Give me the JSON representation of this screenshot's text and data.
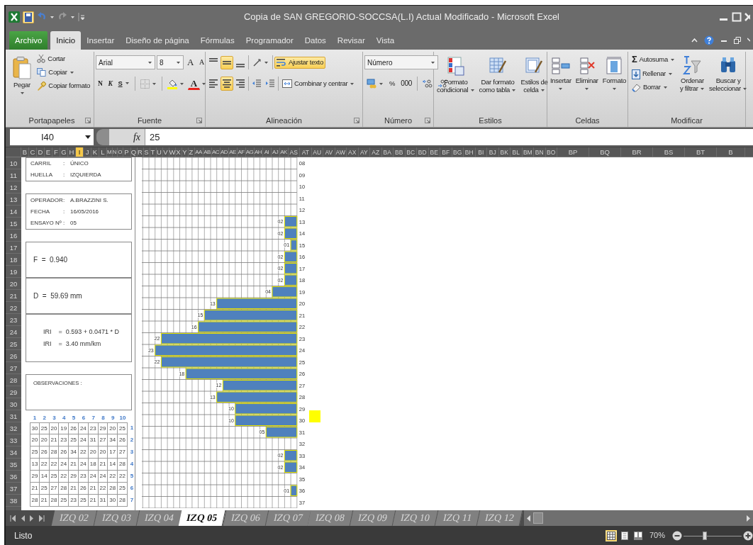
{
  "window": {
    "title": "Copia de SAN GREGORIO-SOCCSA(L.I) Actual Modificado  -  Microsoft Excel"
  },
  "ribbon_tabs": [
    {
      "label": "Archivo",
      "kind": "file",
      "selected": false
    },
    {
      "label": "Inicio",
      "kind": "tab",
      "selected": true
    },
    {
      "label": "Insertar",
      "kind": "tab",
      "selected": false
    },
    {
      "label": "Diseño de página",
      "kind": "tab",
      "selected": false
    },
    {
      "label": "Fórmulas",
      "kind": "tab",
      "selected": false
    },
    {
      "label": "Programador",
      "kind": "tab",
      "selected": false
    },
    {
      "label": "Datos",
      "kind": "tab",
      "selected": false
    },
    {
      "label": "Revisar",
      "kind": "tab",
      "selected": false
    },
    {
      "label": "Vista",
      "kind": "tab",
      "selected": false
    }
  ],
  "ribbon": {
    "clipboard": {
      "label": "Portapapeles",
      "paste": "Pegar",
      "cut": "Cortar",
      "copy": "Copiar",
      "format_painter": "Copiar formato"
    },
    "font": {
      "label": "Fuente",
      "font_name": "Arial",
      "font_size": "8",
      "grow": "A",
      "shrink": "A",
      "bold": "N",
      "italic": "K",
      "underline": "S",
      "font_color": "A"
    },
    "alignment": {
      "label": "Alineación",
      "align_buttons": [
        {
          "kind": "top",
          "selected": false
        },
        {
          "kind": "middle",
          "selected": true
        },
        {
          "kind": "bottom",
          "selected": false
        },
        {
          "kind": "left",
          "selected": false
        },
        {
          "kind": "center",
          "selected": true
        },
        {
          "kind": "right",
          "selected": false
        }
      ],
      "wrap_text": {
        "label": "Ajustar texto",
        "selected": true
      },
      "merge": "Combinar y centrar"
    },
    "number": {
      "label": "Número",
      "format": "Número",
      "percent": "%",
      "thousands": "000"
    },
    "styles": {
      "label": "Estilos",
      "buttons": [
        {
          "kind": "conditional",
          "lines": [
            "Formato",
            "condicional"
          ]
        },
        {
          "kind": "table",
          "lines": [
            "Dar formato",
            "como tabla"
          ]
        },
        {
          "kind": "cell",
          "lines": [
            "Estilos de",
            "celda"
          ]
        }
      ]
    },
    "cells": {
      "label": "Celdas",
      "buttons": [
        {
          "kind": "insert",
          "label": "Insertar"
        },
        {
          "kind": "delete",
          "label": "Eliminar"
        },
        {
          "kind": "format",
          "label": "Formato"
        }
      ]
    },
    "editing": {
      "label": "Modificar",
      "sigma": "Σ",
      "autosum": "Autosuma",
      "fill": "Rellenar",
      "clear": "Borrar",
      "sort": [
        "Ordenar",
        "y filtrar"
      ],
      "find": [
        "Buscar y",
        "seleccionar"
      ]
    }
  },
  "formula_bar": {
    "name_box": "I40",
    "fx": "fx",
    "value": "25"
  },
  "sheet": {
    "column_headers": [
      {
        "label": "B",
        "selected": false
      },
      {
        "label": "C",
        "selected": false
      },
      {
        "label": "D",
        "selected": false
      },
      {
        "label": "E",
        "selected": false
      },
      {
        "label": "F",
        "selected": false
      },
      {
        "label": "G",
        "selected": false
      },
      {
        "label": "H",
        "selected": false
      },
      {
        "label": "I",
        "selected": true
      },
      {
        "label": "J",
        "selected": false
      },
      {
        "label": "K",
        "selected": false
      },
      {
        "label": "L",
        "selected": false
      },
      {
        "label": "M",
        "selected": false
      },
      {
        "label": "N",
        "selected": false
      },
      {
        "label": "O",
        "selected": false
      },
      {
        "label": "P",
        "selected": false
      },
      {
        "label": "Q",
        "selected": false
      },
      {
        "label": "R",
        "selected": false
      },
      {
        "label": "S",
        "selected": false
      },
      {
        "label": "T",
        "selected": false
      },
      {
        "label": "U",
        "selected": false
      },
      {
        "label": "V",
        "selected": false
      },
      {
        "label": "W",
        "selected": false
      },
      {
        "label": "X",
        "selected": false
      },
      {
        "label": "Y",
        "selected": false
      },
      {
        "label": "Z",
        "selected": false
      },
      {
        "label": "AA",
        "selected": false
      },
      {
        "label": "AB",
        "selected": false
      },
      {
        "label": "AC",
        "selected": false
      },
      {
        "label": "AD",
        "selected": false
      },
      {
        "label": "AE",
        "selected": false
      },
      {
        "label": "AF",
        "selected": false
      },
      {
        "label": "AG",
        "selected": false
      },
      {
        "label": "AH",
        "selected": false
      },
      {
        "label": "AI",
        "selected": false
      },
      {
        "label": "AJ",
        "selected": false
      },
      {
        "label": "AK",
        "selected": false
      },
      {
        "label": "AS",
        "selected": false
      },
      {
        "label": "AT",
        "selected": false
      },
      {
        "label": "AU",
        "selected": false
      },
      {
        "label": "AV",
        "selected": false
      },
      {
        "label": "AW",
        "selected": false
      },
      {
        "label": "AX",
        "selected": false
      },
      {
        "label": "AY",
        "selected": false
      },
      {
        "label": "AZ",
        "selected": false
      },
      {
        "label": "BA",
        "selected": false
      },
      {
        "label": "BB",
        "selected": false
      },
      {
        "label": "BC",
        "selected": false
      },
      {
        "label": "BD",
        "selected": false
      },
      {
        "label": "BE",
        "selected": false
      },
      {
        "label": "BF",
        "selected": false
      },
      {
        "label": "BG",
        "selected": false
      },
      {
        "label": "BH",
        "selected": false
      },
      {
        "label": "BI",
        "selected": false
      },
      {
        "label": "BJ",
        "selected": false
      },
      {
        "label": "BK",
        "selected": false
      },
      {
        "label": "BL",
        "selected": false
      },
      {
        "label": "BM",
        "selected": false
      },
      {
        "label": "BN",
        "selected": false
      },
      {
        "label": "BO",
        "selected": false
      },
      {
        "label": "BP",
        "selected": false
      },
      {
        "label": "BQ",
        "selected": false
      },
      {
        "label": "BR",
        "selected": false
      },
      {
        "label": "BS",
        "selected": false
      },
      {
        "label": "BT",
        "selected": false
      },
      {
        "label": "B",
        "selected": false
      }
    ],
    "row_headers": [
      "10",
      "11",
      "12",
      "13",
      "14",
      "15",
      "16",
      "17",
      "18",
      "19",
      "20",
      "21",
      "22",
      "23",
      "24",
      "25",
      "26",
      "27",
      "28",
      "29",
      "30",
      "31",
      "32",
      "33",
      "34",
      "35",
      "36",
      "37",
      "38"
    ],
    "info_boxes": [
      {
        "kind": "fields",
        "rows": [
          {
            "label": "CARRIL",
            "separator": ":",
            "value": "ÚNICO"
          },
          {
            "label": "HUELLA",
            "separator": ":",
            "value": "IZQUIERDA"
          }
        ]
      },
      {
        "kind": "fields",
        "rows": [
          {
            "label": "OPERADOR",
            "separator": ":",
            "value": "A.BRAZZINI S."
          },
          {
            "label": "FECHA",
            "separator": ":",
            "value": "16/05/2016"
          },
          {
            "label": "ENSAYO Nº",
            "separator": ":",
            "value": "05"
          }
        ]
      },
      {
        "kind": "result",
        "lines": [
          "F  =  0.940"
        ]
      },
      {
        "kind": "result",
        "lines": [
          "D  =  59.69 mm"
        ]
      },
      {
        "kind": "formula",
        "lines": [
          "IRI    =  0.593 + 0.0471 * D",
          "IRI    =  3.40 mm/km"
        ]
      },
      {
        "kind": "notes",
        "lines": [
          "OBSERVACIONES :"
        ]
      }
    ],
    "readings": {
      "column_numbers": [
        "1",
        "2",
        "3",
        "4",
        "5",
        "6",
        "7",
        "8",
        "9",
        "10"
      ],
      "rows": [
        {
          "index": "1",
          "values": [
            "30",
            "25",
            "20",
            "19",
            "26",
            "24",
            "23",
            "29",
            "20",
            "25"
          ]
        },
        {
          "index": "2",
          "values": [
            "20",
            "20",
            "21",
            "23",
            "25",
            "24",
            "31",
            "27",
            "34",
            "26"
          ]
        },
        {
          "index": "3",
          "values": [
            "25",
            "26",
            "28",
            "26",
            "34",
            "22",
            "20",
            "20",
            "17",
            "27"
          ]
        },
        {
          "index": "4",
          "values": [
            "13",
            "22",
            "22",
            "24",
            "21",
            "24",
            "18",
            "21",
            "14",
            "28"
          ]
        },
        {
          "index": "5",
          "values": [
            "29",
            "14",
            "25",
            "22",
            "29",
            "23",
            "24",
            "24",
            "22",
            "22"
          ]
        },
        {
          "index": "6",
          "values": [
            "21",
            "25",
            "27",
            "28",
            "21",
            "26",
            "21",
            "22",
            "28",
            "25"
          ]
        },
        {
          "index": "7",
          "values": [
            "28",
            "21",
            "28",
            "25",
            "23",
            "25",
            "21",
            "31",
            "30",
            "28"
          ]
        }
      ]
    },
    "chart": {
      "chart_data": {
        "type": "bar",
        "orientation": "horizontal",
        "xlim": [
          24,
          0
        ],
        "categories": [
          "08",
          "09",
          "10",
          "11",
          "12",
          "13",
          "14",
          "15",
          "16",
          "17",
          "18",
          "19",
          "20",
          "21",
          "22",
          "23",
          "24",
          "25",
          "26",
          "27",
          "28",
          "29",
          "30",
          "31",
          "32",
          "33",
          "34",
          "35",
          "36",
          "37"
        ],
        "values": [
          null,
          null,
          null,
          null,
          null,
          2,
          2,
          1,
          2,
          2,
          2,
          4,
          13,
          15,
          16,
          22,
          23,
          22,
          18,
          12,
          13,
          10,
          10,
          5,
          null,
          2,
          2,
          null,
          1,
          null
        ],
        "value_labels": [
          null,
          null,
          null,
          null,
          null,
          "02",
          "02",
          "01",
          "02",
          "02",
          "02",
          "04",
          "13",
          "15",
          "16",
          "22",
          "23",
          "22",
          "18",
          "12",
          "13",
          "10",
          "10",
          "05",
          null,
          "02",
          "02",
          null,
          "01",
          null
        ]
      }
    }
  },
  "sheet_tabs": [
    {
      "label": "IZQ 02",
      "selected": false
    },
    {
      "label": "IZQ 03",
      "selected": false
    },
    {
      "label": "IZQ 04",
      "selected": false
    },
    {
      "label": "IZQ 05",
      "selected": true
    },
    {
      "label": "IZQ 06",
      "selected": false
    },
    {
      "label": "IZQ 07",
      "selected": false
    },
    {
      "label": "IZQ 08",
      "selected": false
    },
    {
      "label": "IZQ 09",
      "selected": false
    },
    {
      "label": "IZQ 10",
      "selected": false
    },
    {
      "label": "IZQ 11",
      "selected": false
    },
    {
      "label": "IZQ 12",
      "selected": false
    }
  ],
  "status_bar": {
    "text": "Listo",
    "views": [
      {
        "kind": "normal",
        "selected": true
      },
      {
        "kind": "page_layout",
        "selected": false
      },
      {
        "kind": "page_break",
        "selected": false
      }
    ],
    "zoom": "70%",
    "zoom_slider": {
      "level": 0.36
    }
  }
}
